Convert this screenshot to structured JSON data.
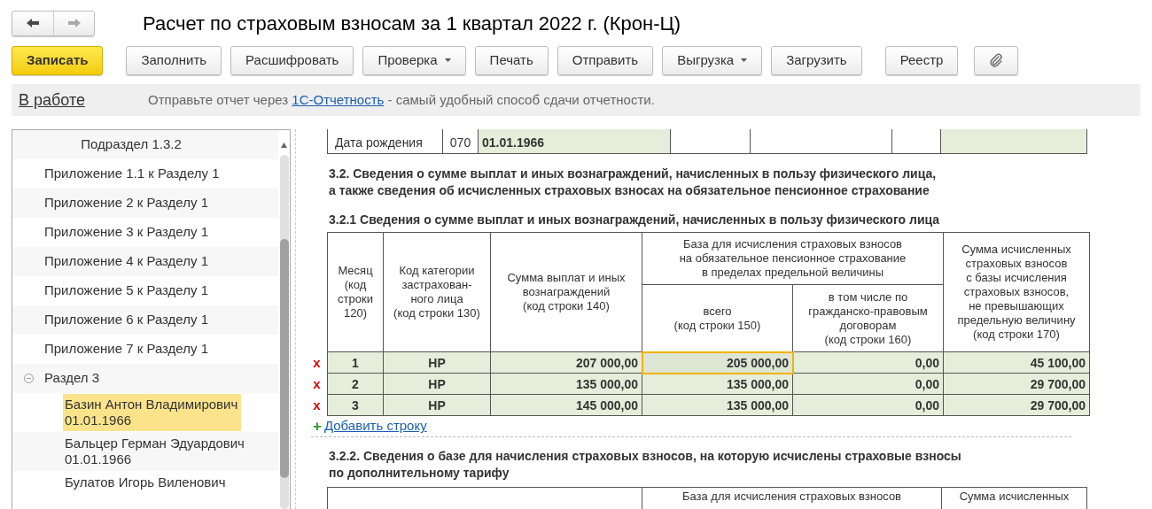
{
  "window": {
    "title": "Расчет по страховым взносам за 1 квартал 2022 г. (Крон-Ц)"
  },
  "nav": [
    {
      "kind": "back",
      "disabled": false
    },
    {
      "kind": "forward",
      "disabled": true
    }
  ],
  "toolbar": [
    {
      "kind": "primary",
      "label": "Записать"
    },
    {
      "kind": "button",
      "label": "Заполнить"
    },
    {
      "kind": "button",
      "label": "Расшифровать"
    },
    {
      "kind": "dropdown",
      "label": "Проверка"
    },
    {
      "kind": "button",
      "label": "Печать"
    },
    {
      "kind": "button",
      "label": "Отправить"
    },
    {
      "kind": "dropdown",
      "label": "Выгрузка"
    },
    {
      "kind": "button",
      "label": "Загрузить"
    },
    {
      "kind": "gap-button",
      "label": "Реестр"
    },
    {
      "kind": "attach"
    }
  ],
  "status_bar": {
    "state": "В работе",
    "message_before": "Отправьте отчет через ",
    "link": "1С-Отчетность",
    "message_after": " - самый удобный способ сдачи отчетности."
  },
  "sidebar": {
    "items": [
      {
        "kind": "subsection",
        "label": "Подраздел 1.3.2"
      },
      {
        "kind": "item",
        "label": "Приложение 1.1 к Разделу 1"
      },
      {
        "kind": "item",
        "label": "Приложение 2 к Разделу 1"
      },
      {
        "kind": "item",
        "label": "Приложение 3 к Разделу 1"
      },
      {
        "kind": "item",
        "label": "Приложение 4 к Разделу 1"
      },
      {
        "kind": "item",
        "label": "Приложение 5 к Разделу 1"
      },
      {
        "kind": "item",
        "label": "Приложение 6 к Разделу 1"
      },
      {
        "kind": "item",
        "label": "Приложение 7 к Разделу 1"
      },
      {
        "kind": "group",
        "label": "Раздел 3",
        "expanded": true,
        "children": [
          {
            "label": "Базин Антон Владимирович",
            "date": "01.01.1966",
            "selected": true
          },
          {
            "label": "Бальцер Герман Эдуардович",
            "date": "01.01.1966",
            "selected": false
          },
          {
            "label": "Булатов Игорь Виленович",
            "selected": false
          }
        ]
      }
    ]
  },
  "document": {
    "top_row": [
      "Дата рождения",
      "070",
      "01.01.1966"
    ],
    "heading_3_2": "3.2. Сведения о сумме выплат и иных вознаграждений, начисленных в пользу физического лица,\nа также сведения об исчисленных страховых взносах на обязательное пенсионное страхование",
    "heading_3_2_1": "3.2.1 Сведения о сумме выплат и иных вознаграждений, начисленных в пользу физического лица",
    "table": {
      "header_rows": [
        [
          {
            "label": "Месяц\n(код\nстроки\n120)",
            "rowspan": 2
          },
          {
            "label": "Код категории\nзастрахован-\nного лица\n(код строки 130)",
            "rowspan": 2
          },
          {
            "label": "Сумма выплат и иных\nвознаграждений\n(код строки 140)",
            "rowspan": 2
          },
          {
            "label": "База для исчисления страховых взносов\nна обязательное пенсионное страхование\nв пределах предельной величины",
            "colspan": 2
          },
          {
            "label": "Сумма исчисленных\nстраховых взносов\nс базы исчисления\nстраховых взносов,\nне превышающих\nпредельную величину\n(код строки 170)",
            "rowspan": 2
          }
        ],
        [
          {
            "label": "всего\n(код строки 150)"
          },
          {
            "label": "в том числе по\nгражданско-правовым\nдоговорам\n(код строки 160)"
          }
        ]
      ],
      "rows": [
        {
          "delete": "x",
          "cells": [
            {
              "value": "1",
              "focused": false
            },
            {
              "value": "НР",
              "focused": false
            },
            {
              "value": "207 000,00",
              "focused": false
            },
            {
              "value": "205 000,00",
              "focused": true
            },
            {
              "value": "0,00",
              "focused": false
            },
            {
              "value": "45 100,00",
              "focused": false
            }
          ]
        },
        {
          "delete": "x",
          "cells": [
            {
              "value": "2",
              "focused": false
            },
            {
              "value": "НР",
              "focused": false
            },
            {
              "value": "135 000,00",
              "focused": false
            },
            {
              "value": "135 000,00",
              "focused": false
            },
            {
              "value": "0,00",
              "focused": false
            },
            {
              "value": "29 700,00",
              "focused": false
            }
          ]
        },
        {
          "delete": "x",
          "cells": [
            {
              "value": "3",
              "focused": false
            },
            {
              "value": "НР",
              "focused": false
            },
            {
              "value": "145 000,00",
              "focused": false
            },
            {
              "value": "135 000,00",
              "focused": false
            },
            {
              "value": "0,00",
              "focused": false
            },
            {
              "value": "29 700,00",
              "focused": false
            }
          ]
        }
      ],
      "add_icon": "+",
      "add_link": "Добавить строку"
    },
    "heading_3_2_2": "3.2.2. Сведения о базе для начисления страховых взносов, на которую исчислены страховые взносы\nпо дополнительному тарифу",
    "next_table_columns": [
      "База для исчисления страховых взносов",
      "Сумма исчисленных"
    ]
  }
}
